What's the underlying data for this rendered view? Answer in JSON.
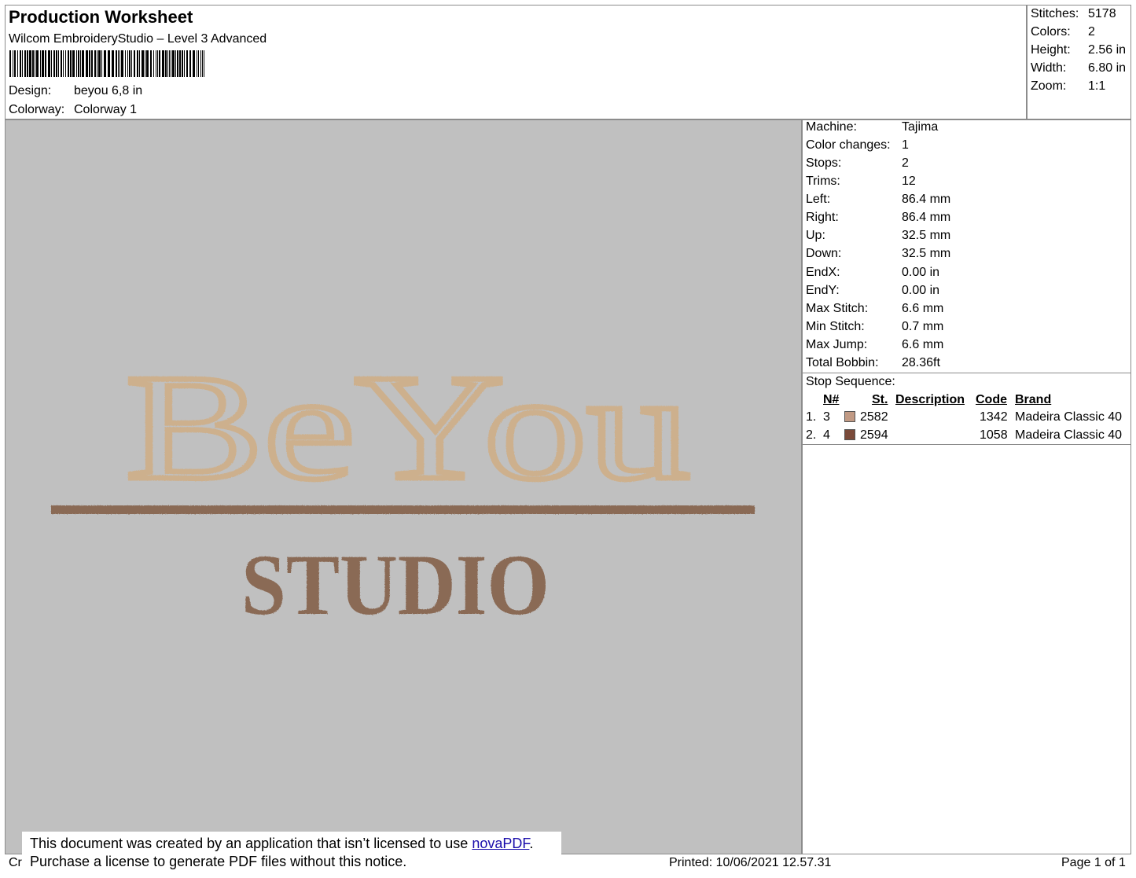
{
  "header": {
    "title": "Production Worksheet",
    "software": "Wilcom EmbroideryStudio – Level 3 Advanced",
    "design_label": "Design:",
    "design_value": "beyou 6,8 in",
    "colorway_label": "Colorway:",
    "colorway_value": "Colorway 1"
  },
  "summary": [
    {
      "label": "Stitches:",
      "value": "5178"
    },
    {
      "label": "Colors:",
      "value": "2"
    },
    {
      "label": "Height:",
      "value": "2.56 in"
    },
    {
      "label": "Width:",
      "value": "6.80 in"
    },
    {
      "label": "Zoom:",
      "value": "1:1"
    }
  ],
  "design_preview": {
    "line1": "BeYou",
    "line2": "Studio",
    "thread_light": "#cdb08d",
    "thread_dark": "#8a6a55",
    "background": "#c0c0c0"
  },
  "machine_details": [
    {
      "label": "Machine:",
      "value": "Tajima"
    },
    {
      "label": "Color changes:",
      "value": "1"
    },
    {
      "label": "Stops:",
      "value": "2"
    },
    {
      "label": "Trims:",
      "value": "12"
    },
    {
      "label": "Left:",
      "value": "86.4 mm"
    },
    {
      "label": "Right:",
      "value": "86.4 mm"
    },
    {
      "label": "Up:",
      "value": "32.5 mm"
    },
    {
      "label": "Down:",
      "value": "32.5 mm"
    },
    {
      "label": "EndX:",
      "value": "0.00 in"
    },
    {
      "label": "EndY:",
      "value": "0.00 in"
    },
    {
      "label": "Max Stitch:",
      "value": "6.6 mm"
    },
    {
      "label": "Min Stitch:",
      "value": "0.7 mm"
    },
    {
      "label": "Max Jump:",
      "value": "6.6 mm"
    },
    {
      "label": "Total Bobbin:",
      "value": "28.36ft"
    }
  ],
  "stop_sequence": {
    "title": "Stop Sequence:",
    "headers": {
      "n": "N#",
      "st": "St.",
      "description": "Description",
      "code": "Code",
      "brand": "Brand"
    },
    "rows": [
      {
        "index": "1.",
        "n": "3",
        "color": "#c19a84",
        "st": "2582",
        "description": "",
        "code": "1342",
        "brand": "Madeira Classic 40"
      },
      {
        "index": "2.",
        "n": "4",
        "color": "#7a4a3a",
        "st": "2594",
        "description": "",
        "code": "1058",
        "brand": "Madeira Classic 40"
      }
    ]
  },
  "footer": {
    "left_fragment": "Cr",
    "printed": "Printed: 10/06/2021 12.57.31",
    "page": "Page 1 of 1"
  },
  "notice": {
    "line1_text": "This document was created by an application that isn’t licensed to use ",
    "link": "novaPDF",
    "line1_end": ".",
    "line2": "Purchase a license to generate PDF files without this notice."
  }
}
